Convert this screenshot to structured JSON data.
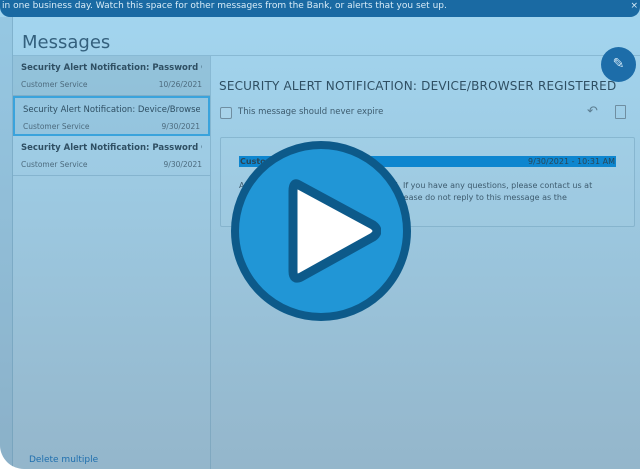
{
  "banner": {
    "text": "in one business day. Watch this space for other messages from the Bank, or alerts that you set up.",
    "close": "×"
  },
  "page_title": "Messages",
  "messages": [
    {
      "subject": "Security Alert Notification: Password C...",
      "from": "Customer Service",
      "date": "10/26/2021"
    },
    {
      "subject": "Security Alert Notification: Device/Browse...",
      "from": "Customer Service",
      "date": "9/30/2021"
    },
    {
      "subject": "Security Alert Notification: Password C...",
      "from": "Customer Service",
      "date": "9/30/2021"
    }
  ],
  "delete_multiple": "Delete multiple",
  "detail": {
    "heading": "SECURITY ALERT NOTIFICATION: DEVICE/BROWSER REGISTERED",
    "never_expire": "This message should never expire",
    "from": "Custo",
    "timestamp": "9/30/2021 - 10:31 AM",
    "body_line1": "A                                                    tered. If you have any questions, please contact us at",
    "body_line2": "                                                       om. Please do not reply to this message as the"
  },
  "icons": {
    "compose": "pencil-icon",
    "reply": "reply-icon",
    "delete": "trash-icon",
    "play": "play-icon"
  }
}
